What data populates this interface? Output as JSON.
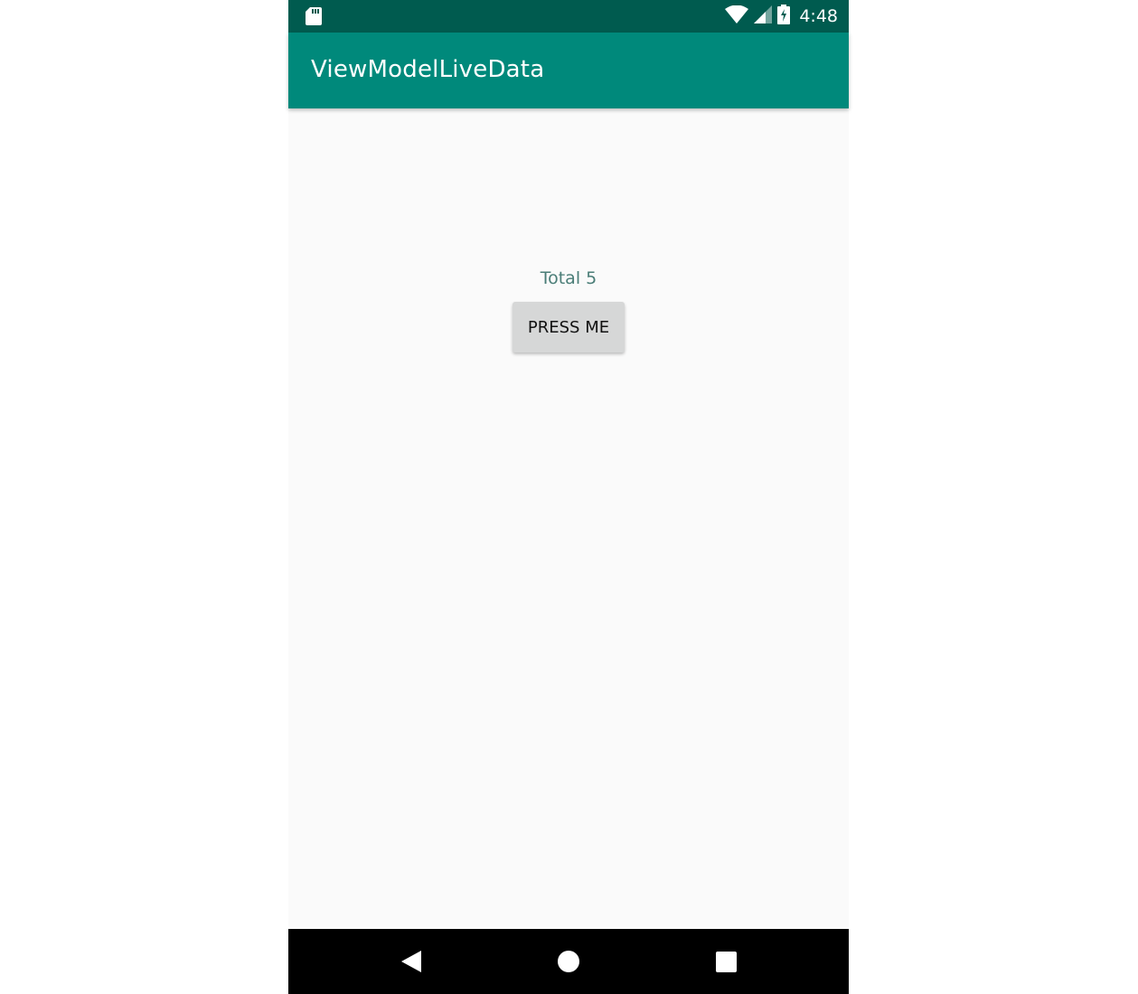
{
  "status_bar": {
    "time": "4:48",
    "left_icons": [
      "sd-card-icon"
    ],
    "right_icons": [
      "wifi-icon",
      "cell-signal-icon",
      "battery-charging-icon"
    ]
  },
  "app_bar": {
    "title": "ViewModelLiveData"
  },
  "main": {
    "total_text": "Total 5",
    "press_button_label": "PRESS ME"
  },
  "nav_bar": {
    "buttons": [
      "back-icon",
      "home-icon",
      "recents-icon"
    ]
  },
  "colors": {
    "status_bar": "#005b4f",
    "app_bar": "#00897b",
    "background": "#fafafa",
    "button": "#d6d7d7",
    "total_text": "#4a7d77",
    "nav_bar": "#000000"
  }
}
